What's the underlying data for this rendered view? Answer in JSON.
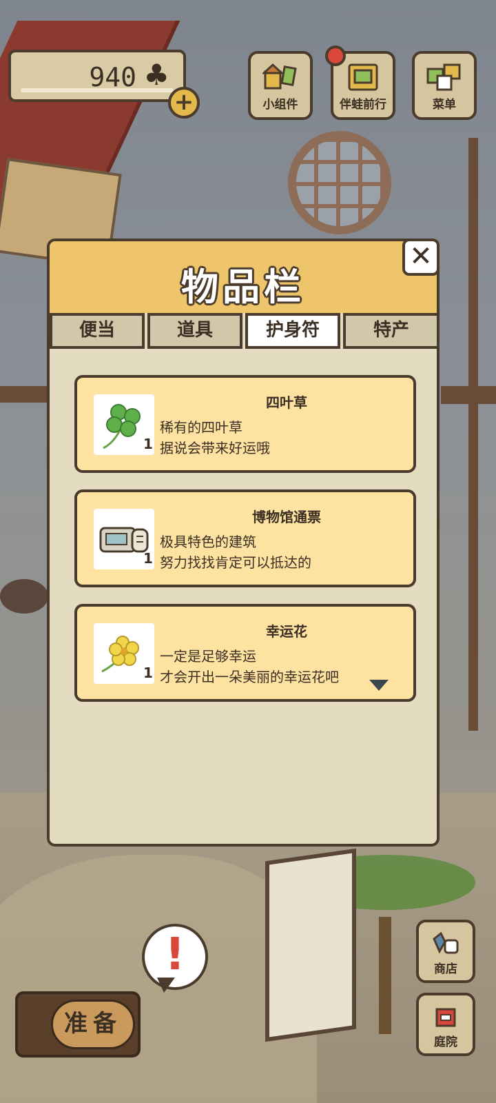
{
  "hud": {
    "clover_count": "940",
    "clover_icon": "♣",
    "add_label": "+",
    "buttons": [
      {
        "label": "小组件",
        "icon": "widget-icon"
      },
      {
        "label": "伴蛙前行",
        "icon": "journey-icon"
      },
      {
        "label": "菜单",
        "icon": "menu-icon"
      }
    ]
  },
  "modal": {
    "title": "物品栏",
    "close_label": "✕",
    "tabs": [
      {
        "label": "便当",
        "active": false
      },
      {
        "label": "道具",
        "active": false
      },
      {
        "label": "护身符",
        "active": true
      },
      {
        "label": "特产",
        "active": false
      }
    ],
    "items": [
      {
        "name": "四叶草",
        "qty": "1",
        "desc1": "稀有的四叶草",
        "desc2": "据说会带来好运哦",
        "icon": "four-leaf-clover-icon"
      },
      {
        "name": "博物馆通票",
        "qty": "1",
        "desc1": "极具特色的建筑",
        "desc2": "努力找找肯定可以抵达的",
        "icon": "museum-ticket-icon"
      },
      {
        "name": "幸运花",
        "qty": "1",
        "desc1": "一定是足够幸运",
        "desc2": "才会开出一朵美丽的幸运花吧",
        "icon": "lucky-flower-icon"
      }
    ]
  },
  "bottom": {
    "alert_mark": "!",
    "prepare_label": "准备",
    "shop_label": "商店",
    "yard_label": "庭院"
  },
  "colors": {
    "header": "#eec56a",
    "card": "#fde2a1",
    "panel": "#e4dcc1",
    "outline": "#4a3b2c"
  }
}
